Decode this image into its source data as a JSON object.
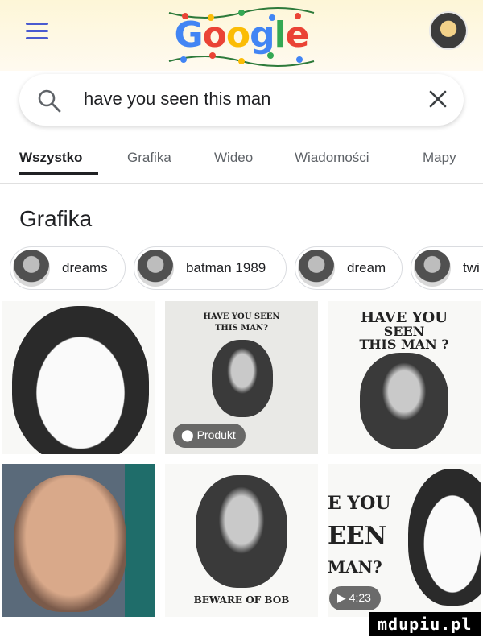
{
  "header": {
    "logo_letters": [
      {
        "ch": "G",
        "color": "#4285f4"
      },
      {
        "ch": "o",
        "color": "#ea4335"
      },
      {
        "ch": "o",
        "color": "#fbbc05"
      },
      {
        "ch": "g",
        "color": "#4285f4"
      },
      {
        "ch": "l",
        "color": "#34a853"
      },
      {
        "ch": "e",
        "color": "#ea4335"
      }
    ],
    "menu_icon": "hamburger-menu-icon",
    "avatar_icon": "account-avatar"
  },
  "search": {
    "query": "have you seen this man",
    "search_icon": "magnifier-icon",
    "clear_icon": "close-icon"
  },
  "tabs": [
    {
      "label": "Wszystko",
      "active": true
    },
    {
      "label": "Grafika",
      "active": false
    },
    {
      "label": "Wideo",
      "active": false
    },
    {
      "label": "Wiadomości",
      "active": false
    },
    {
      "label": "Mapy",
      "active": false
    }
  ],
  "section": {
    "title": "Grafika"
  },
  "chips": [
    {
      "label": "dreams"
    },
    {
      "label": "batman 1989"
    },
    {
      "label": "dream"
    },
    {
      "label": "twi"
    }
  ],
  "results": {
    "poster2": {
      "line1": "HAVE YOU SEEN",
      "line2": "THIS MAN?"
    },
    "poster3": {
      "line1": "HAVE YOU",
      "line2": "SEEN",
      "line3": "THIS MAN ?"
    },
    "product_badge": "Produkt",
    "poster5_footer": "BEWARE OF BOB",
    "poster6": {
      "line1": "E YOU",
      "line2": "EEN",
      "line3": "MAN?"
    },
    "video_duration": "4:23"
  },
  "watermark": "mdupiu.pl",
  "colors": {
    "accent": "#4285f4",
    "active_tab": "#202124",
    "inactive_tab": "#5f6368"
  }
}
